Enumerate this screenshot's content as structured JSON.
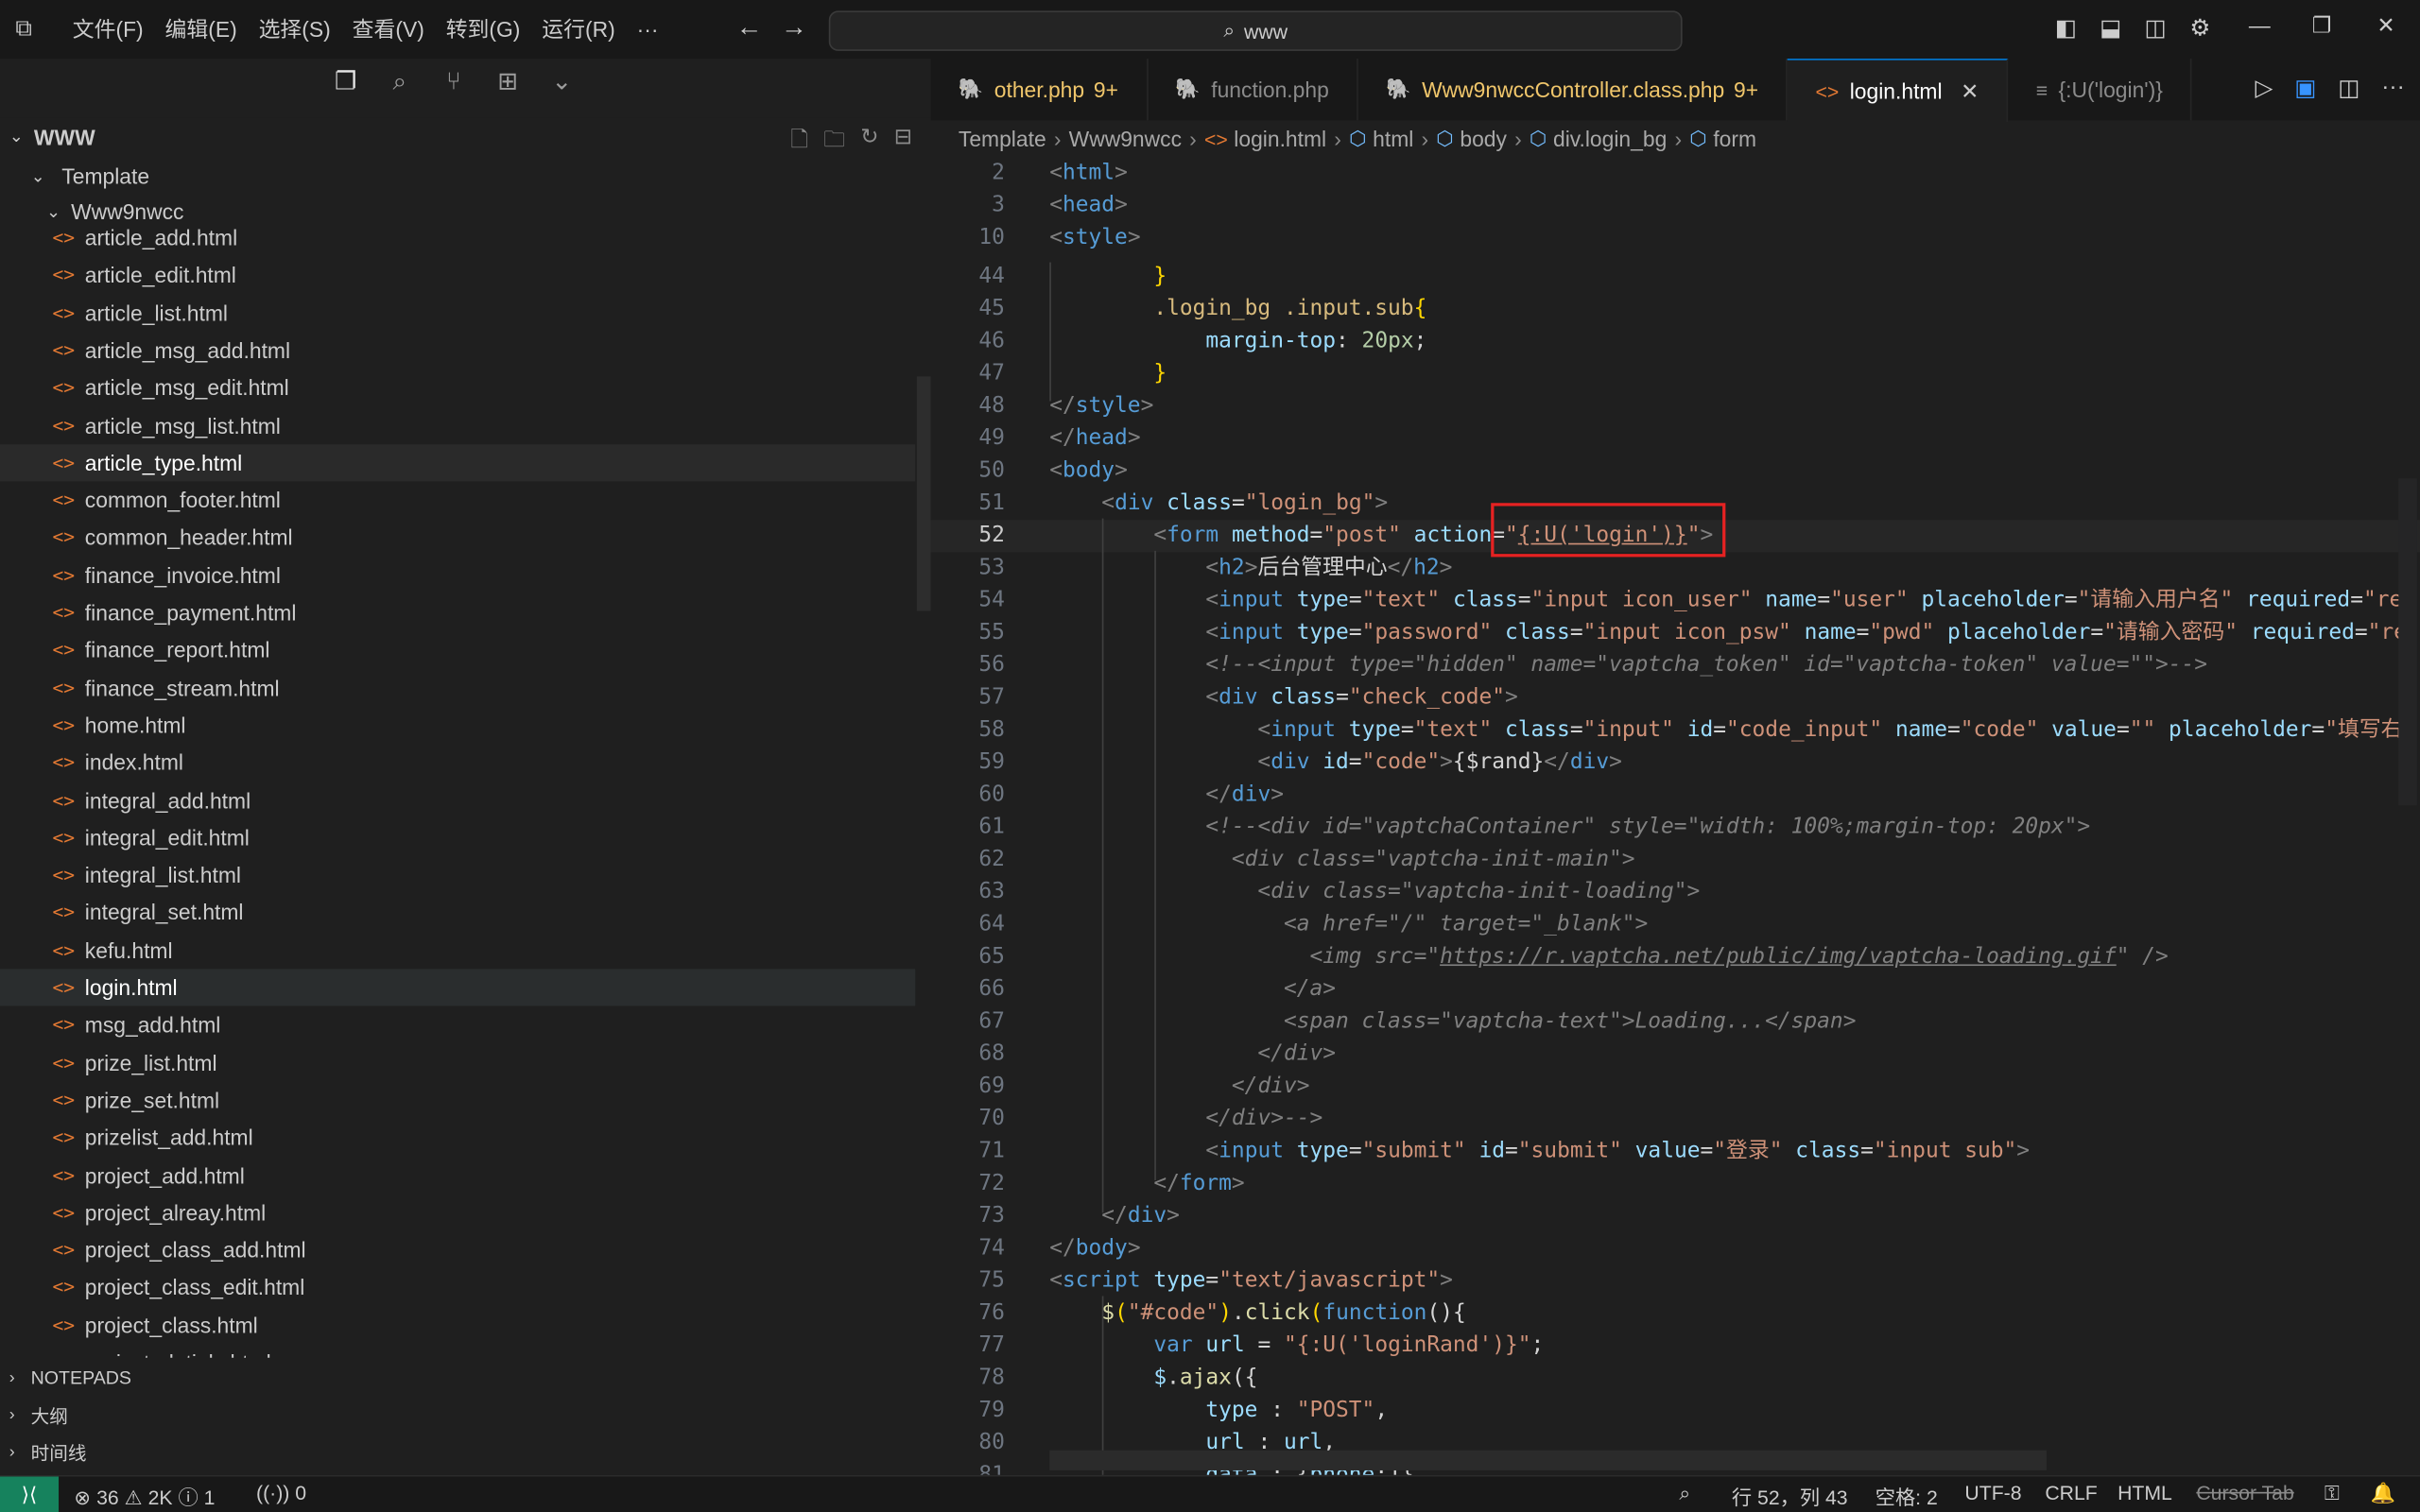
{
  "menu": [
    "文件(F)",
    "编辑(E)",
    "选择(S)",
    "查看(V)",
    "转到(G)",
    "运行(R)",
    "···"
  ],
  "search": {
    "text": "www"
  },
  "explorer": {
    "workspace": "WWW",
    "folder": "Template",
    "subfolder": "Www9nwcc",
    "files": [
      "article_add.html",
      "article_edit.html",
      "article_list.html",
      "article_msg_add.html",
      "article_msg_edit.html",
      "article_msg_list.html",
      "article_type.html",
      "common_footer.html",
      "common_header.html",
      "finance_invoice.html",
      "finance_payment.html",
      "finance_report.html",
      "finance_stream.html",
      "home.html",
      "index.html",
      "integral_add.html",
      "integral_edit.html",
      "integral_list.html",
      "integral_set.html",
      "kefu.html",
      "login.html",
      "msg_add.html",
      "prize_list.html",
      "prize_set.html",
      "prizelist_add.html",
      "project_add.html",
      "project_alreay.html",
      "project_class_add.html",
      "project_class_edit.html",
      "project_class.html",
      "project_detials.html"
    ],
    "hovered_file": "article_type.html",
    "selected_file": "login.html",
    "sections": [
      "NOTEPADS",
      "大纲",
      "时间线"
    ]
  },
  "tabs": [
    {
      "label": "other.php",
      "badge": "9+",
      "style": "warn"
    },
    {
      "label": "function.php",
      "badge": "",
      "style": "dim"
    },
    {
      "label": "Www9nwccController.class.php",
      "badge": "9+",
      "style": "warn"
    },
    {
      "label": "login.html",
      "badge": "",
      "style": "active"
    },
    {
      "label": "{:U('login')}",
      "badge": "",
      "style": "dim"
    }
  ],
  "breadcrumb": [
    "Template",
    "Www9nwcc",
    "login.html",
    "html",
    "body",
    "div.login_bg",
    "form"
  ],
  "status": {
    "errors": "36",
    "warnings": "2K",
    "info": "1",
    "ports": "0",
    "position": "行 52，列 43",
    "indent": "空格: 2",
    "encoding": "UTF-8",
    "eol": "CRLF",
    "language": "HTML",
    "cursor_tab": "Cursor Tab"
  },
  "colors": {
    "accent": "#0078d4",
    "remote": "#16825d",
    "highlight_box": "#e52222"
  }
}
